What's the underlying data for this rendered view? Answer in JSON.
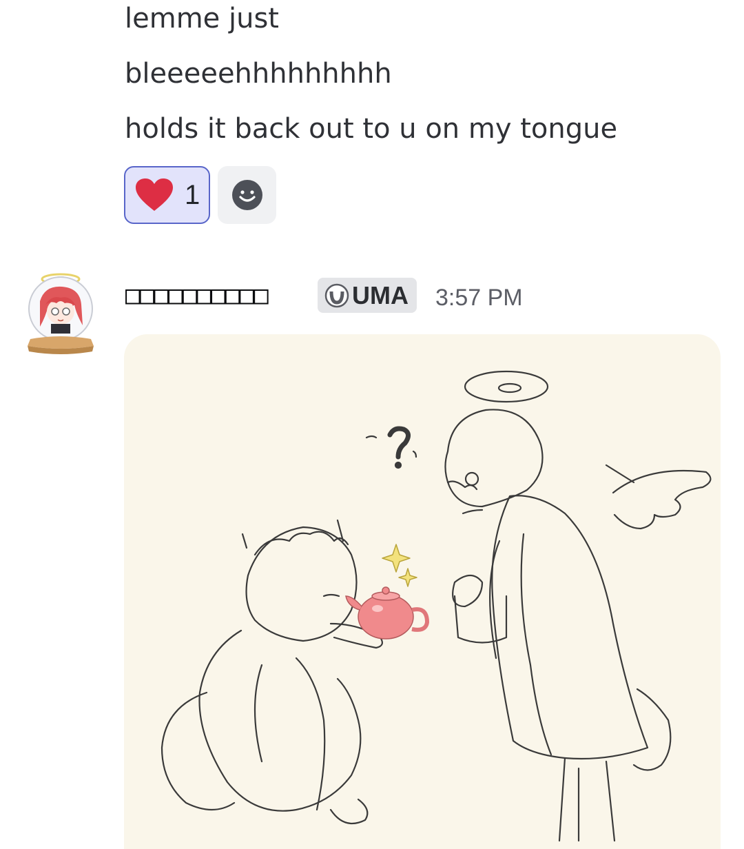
{
  "messages": {
    "previous": {
      "lines": [
        "lemme just",
        "bleeeeehhhhhhhhh",
        "holds it back out to u on my tongue"
      ],
      "reactions": [
        {
          "emoji": "heart",
          "count": "1",
          "active": true
        }
      ],
      "add_reaction_icon": "smiley-icon"
    },
    "current": {
      "username": "□□□□□□□□□□",
      "tag": "UMA",
      "tag_icon": "horseshoe-icon",
      "timestamp": "3:57 PM",
      "attachment": {
        "type": "image",
        "description_icon": "sketch-image"
      }
    }
  },
  "colors": {
    "reaction_active_bg": "#e2e3fb",
    "reaction_active_border": "#5865c9",
    "heart": "#dd2e44",
    "attachment_bg": "#faf6ea",
    "teapot": "#f08a8c"
  }
}
